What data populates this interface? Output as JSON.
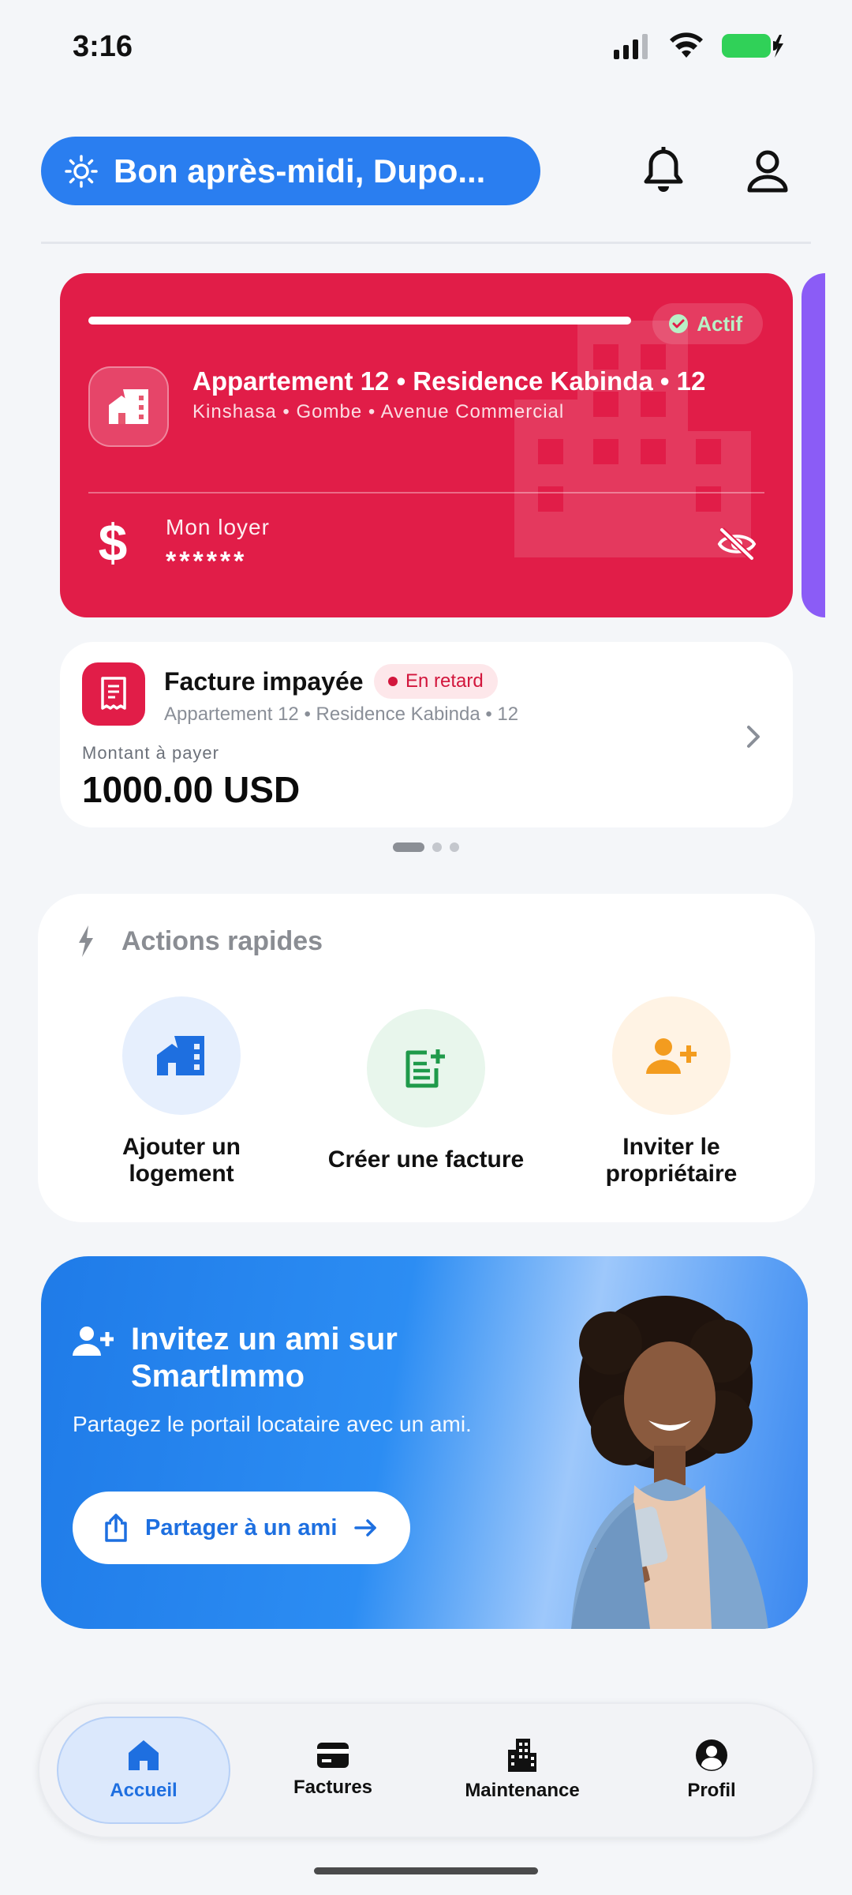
{
  "status_bar": {
    "time": "3:16",
    "battery_color": "#30d158"
  },
  "header": {
    "greeting": "Bon après-midi, Dupo...",
    "icons": [
      "sun-icon",
      "bell-icon",
      "user-icon"
    ]
  },
  "property_card": {
    "status": "Actif",
    "title": "Appartement 12 • Residence Kabinda • 12",
    "address": "Kinshasa • Gombe • Avenue Commercial",
    "rent_label": "Mon loyer",
    "rent_value": "******",
    "color": "#e11d48"
  },
  "invoice_card": {
    "title": "Facture impayée",
    "badge": "En retard",
    "subtitle": "Appartement 12 • Residence Kabinda • 12",
    "amount_label": "Montant à payer",
    "amount_value": "1000.00 USD"
  },
  "quick_actions": {
    "title": "Actions rapides",
    "items": [
      {
        "label_line1": "Ajouter un",
        "label_line2": "logement",
        "icon": "add-home-icon",
        "bg": "#e6effd",
        "color": "#1e6fe0"
      },
      {
        "label_line1": "Créer une facture",
        "label_line2": "",
        "icon": "add-invoice-icon",
        "bg": "#e8f6ec",
        "color": "#1f9a4a"
      },
      {
        "label_line1": "Inviter le",
        "label_line2": "propriétaire",
        "icon": "invite-owner-icon",
        "bg": "#fff3e4",
        "color": "#f39c1f"
      }
    ]
  },
  "invite_banner": {
    "title": "Invitez un ami sur SmartImmo",
    "text": "Partagez le portail locataire avec un ami.",
    "button": "Partager à un ami"
  },
  "bottom_nav": {
    "items": [
      {
        "label": "Accueil",
        "icon": "home-icon",
        "active": true
      },
      {
        "label": "Factures",
        "icon": "card-icon",
        "active": false
      },
      {
        "label": "Maintenance",
        "icon": "building-icon",
        "active": false
      },
      {
        "label": "Profil",
        "icon": "profile-icon",
        "active": false
      }
    ]
  }
}
